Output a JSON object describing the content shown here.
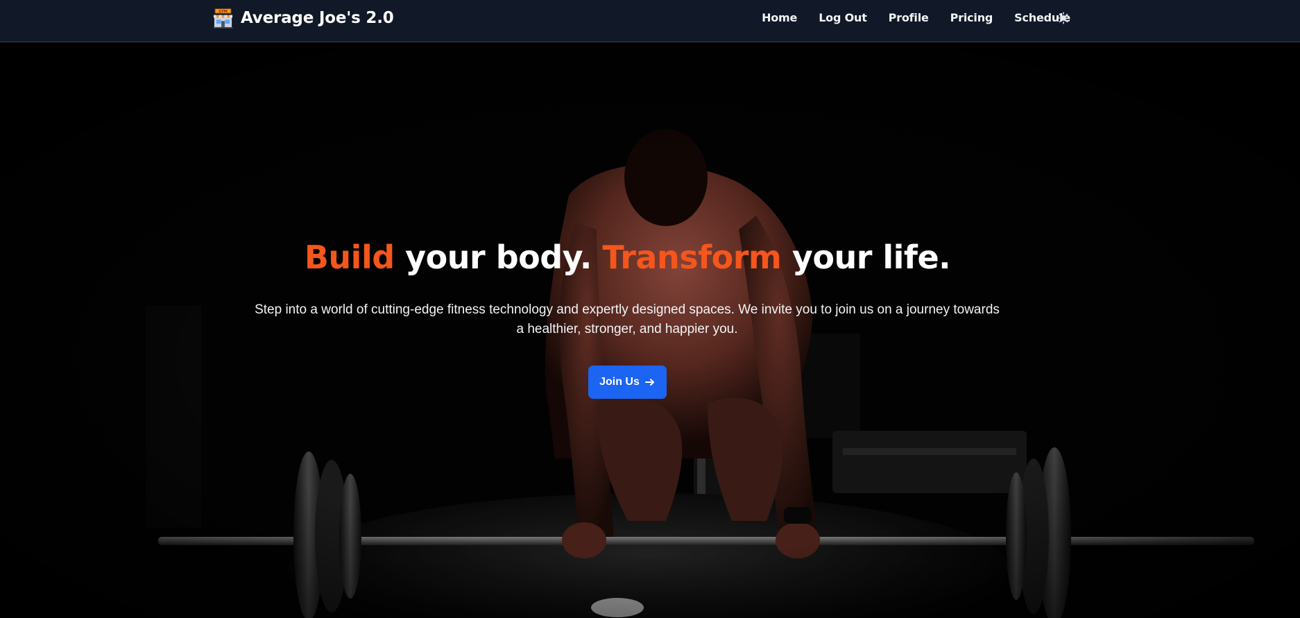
{
  "brand": {
    "name": "Average Joe's 2.0",
    "logo_icon": "gym-building-icon",
    "logo_text": "GYM"
  },
  "nav": {
    "links": [
      "Home",
      "Log Out",
      "Profile",
      "Pricing",
      "Schedule"
    ],
    "theme_toggle_icon": "sun-icon"
  },
  "hero": {
    "title_accent_1": "Build",
    "title_part_1": " your body. ",
    "title_accent_2": "Transform",
    "title_part_2": " your life.",
    "subtitle": "Step into a world of cutting-edge fitness technology and expertly designed spaces. We invite you to join us on a journey towards a healthier, stronger, and happier you.",
    "cta_label": "Join Us",
    "cta_icon": "arrow-right-icon",
    "background": "photo of a muscular man gripping a barbell in a dark gym"
  },
  "colors": {
    "navbar_bg": "#111827",
    "accent": "#f4561c",
    "button": "#1c64f2",
    "text": "#ffffff"
  }
}
